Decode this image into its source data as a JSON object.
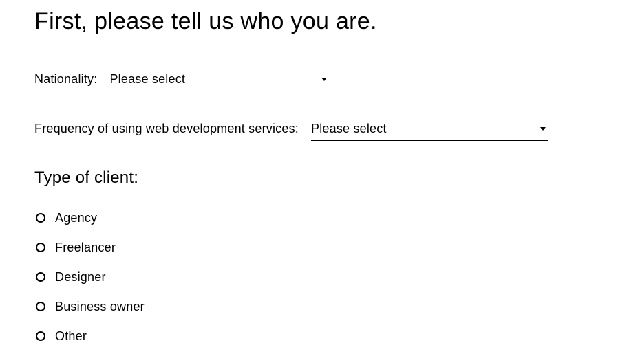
{
  "heading": "First, please tell us who you are.",
  "nationality": {
    "label": "Nationality:",
    "value": "Please select"
  },
  "frequency": {
    "label": "Frequency of using web development services:",
    "value": "Please select"
  },
  "client_type": {
    "heading": "Type of client:",
    "options": [
      {
        "label": "Agency"
      },
      {
        "label": "Freelancer"
      },
      {
        "label": "Designer"
      },
      {
        "label": "Business owner"
      },
      {
        "label": "Other"
      }
    ]
  }
}
